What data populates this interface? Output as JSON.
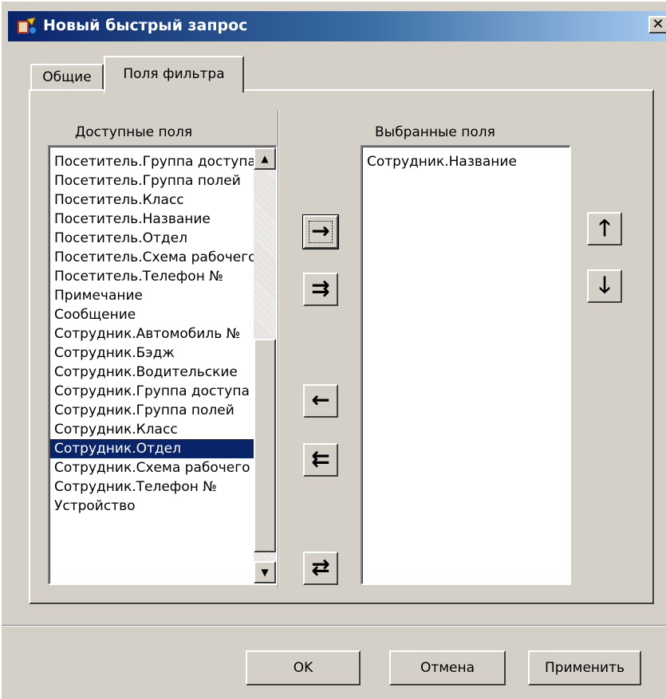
{
  "window": {
    "title": "Новый быстрый запрос",
    "close_label": "✕"
  },
  "tabs": [
    {
      "label": "Общие",
      "active": false
    },
    {
      "label": "Поля фильтра",
      "active": true
    }
  ],
  "available": {
    "label": "Доступные поля",
    "items": [
      "Посетитель.Группа доступа",
      "Посетитель.Группа полей",
      "Посетитель.Класс",
      "Посетитель.Название",
      "Посетитель.Отдел",
      "Посетитель.Схема рабочего",
      "Посетитель.Телефон №",
      "Примечание",
      "Сообщение",
      "Сотрудник.Автомобиль №",
      "Сотрудник.Бэдж",
      "Сотрудник.Водительские",
      "Сотрудник.Группа доступа",
      "Сотрудник.Группа полей",
      "Сотрудник.Класс",
      "Сотрудник.Отдел",
      "Сотрудник.Схема рабочего",
      "Сотрудник.Телефон №",
      "Устройство"
    ],
    "selected_index": 15
  },
  "selected": {
    "label": "Выбранные поля",
    "items": [
      "Сотрудник.Название"
    ]
  },
  "arrows": {
    "add": "→",
    "add_all": "⇉",
    "remove": "←",
    "remove_all": "⇇",
    "swap": "⇄",
    "move_up": "🡑",
    "move_down": "🡓",
    "scroll_up": "▲",
    "scroll_down": "▼"
  },
  "buttons": {
    "ok": "OK",
    "cancel": "Отмена",
    "apply": "Применить"
  }
}
